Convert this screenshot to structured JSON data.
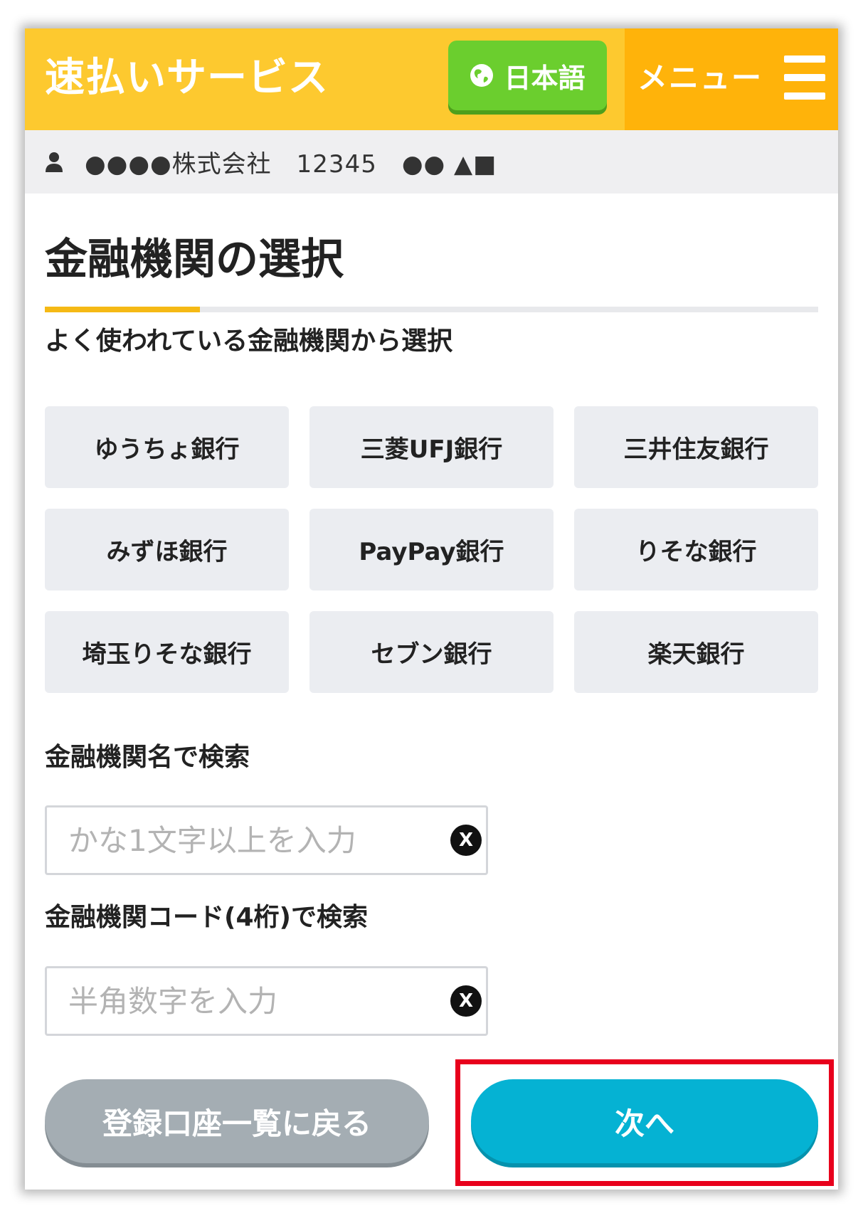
{
  "header": {
    "title": "速払いサービス",
    "language_label": "日本語",
    "menu_label": "メニュー"
  },
  "user_bar": {
    "text": "●●●●株式会社　12345　●● ▲■"
  },
  "page_title": "金融機関の選択",
  "frequent": {
    "label": "よく使われている金融機関から選択",
    "banks": [
      "ゆうちょ銀行",
      "三菱UFJ銀行",
      "三井住友銀行",
      "みずほ銀行",
      "PayPay銀行",
      "りそな銀行",
      "埼玉りそな銀行",
      "セブン銀行",
      "楽天銀行"
    ]
  },
  "search_name": {
    "label": "金融機関名で検索",
    "placeholder": "かな1文字以上を入力",
    "value": ""
  },
  "search_code": {
    "label": "金融機関コード(4桁)で検索",
    "placeholder": "半角数字を入力",
    "value": ""
  },
  "clear_symbol": "X",
  "buttons": {
    "back": "登録口座一覧に戻る",
    "next": "次へ"
  },
  "colors": {
    "header": "#fdc92f",
    "menu": "#ffb30a",
    "language": "#6bce2e",
    "accent_rule": "#f5b915",
    "next": "#05b2d3",
    "back": "#a4adb3",
    "highlight": "#e8001c"
  }
}
